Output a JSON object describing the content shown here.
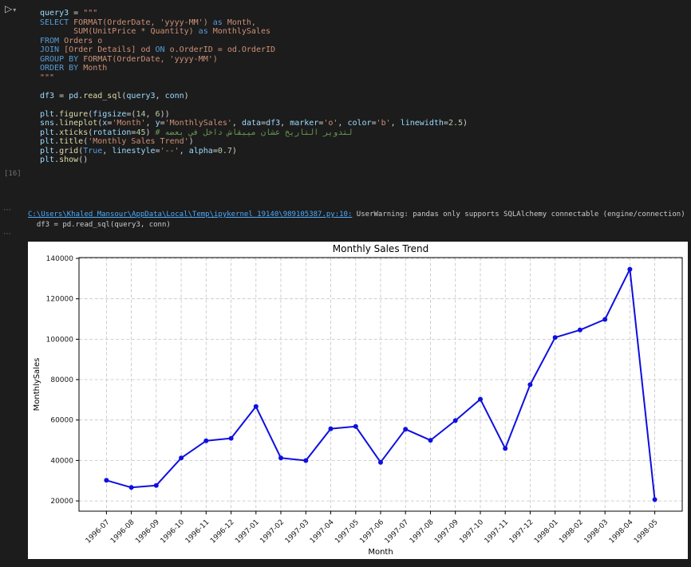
{
  "colors": {
    "page_bg": "#1c1c1c",
    "accent_link": "#4daafc",
    "chart_line": "#0f0fe0",
    "syntax": {
      "var": "#9cdcfe",
      "fg": "#d4d4d4",
      "str": "#ce9178",
      "kw": "#569cd6",
      "fn": "#dcdcaa",
      "num": "#b5cea8",
      "com": "#6a9955"
    }
  },
  "cell": {
    "run_icon": "▷",
    "dropdown_icon": "▾",
    "execution_count": "[16]",
    "code_lines": [
      [
        {
          "t": "query3",
          "c": "var"
        },
        {
          "t": " = ",
          "c": "fg"
        },
        {
          "t": "\"\"\"",
          "c": "str"
        }
      ],
      [
        {
          "t": "SELECT",
          "c": "kw"
        },
        {
          "t": " FORMAT(OrderDate, 'yyyy-MM')",
          "c": "str"
        },
        {
          "t": " as ",
          "c": "kw"
        },
        {
          "t": "Month,",
          "c": "str"
        }
      ],
      [
        {
          "t": "       SUM(UnitPrice * Quantity)",
          "c": "str"
        },
        {
          "t": " as ",
          "c": "kw"
        },
        {
          "t": "MonthlySales",
          "c": "str"
        }
      ],
      [
        {
          "t": "FROM",
          "c": "kw"
        },
        {
          "t": " Orders o",
          "c": "str"
        }
      ],
      [
        {
          "t": "JOIN",
          "c": "kw"
        },
        {
          "t": " [Order Details] od ",
          "c": "str"
        },
        {
          "t": "ON",
          "c": "kw"
        },
        {
          "t": " o.OrderID = od.OrderID",
          "c": "str"
        }
      ],
      [
        {
          "t": "GROUP BY",
          "c": "kw"
        },
        {
          "t": " FORMAT(OrderDate, 'yyyy-MM')",
          "c": "str"
        }
      ],
      [
        {
          "t": "ORDER BY",
          "c": "kw"
        },
        {
          "t": " Month",
          "c": "str"
        }
      ],
      [
        {
          "t": "\"\"\"",
          "c": "str"
        }
      ],
      [],
      [
        {
          "t": "df3",
          "c": "var"
        },
        {
          "t": " = ",
          "c": "fg"
        },
        {
          "t": "pd",
          "c": "var"
        },
        {
          "t": ".",
          "c": "fg"
        },
        {
          "t": "read_sql",
          "c": "fn"
        },
        {
          "t": "(",
          "c": "fg"
        },
        {
          "t": "query3",
          "c": "var"
        },
        {
          "t": ", ",
          "c": "fg"
        },
        {
          "t": "conn",
          "c": "var"
        },
        {
          "t": ")",
          "c": "fg"
        }
      ],
      [],
      [
        {
          "t": "plt",
          "c": "var"
        },
        {
          "t": ".",
          "c": "fg"
        },
        {
          "t": "figure",
          "c": "fn"
        },
        {
          "t": "(",
          "c": "fg"
        },
        {
          "t": "figsize",
          "c": "var"
        },
        {
          "t": "=(",
          "c": "fg"
        },
        {
          "t": "14",
          "c": "num"
        },
        {
          "t": ", ",
          "c": "fg"
        },
        {
          "t": "6",
          "c": "num"
        },
        {
          "t": "))",
          "c": "fg"
        }
      ],
      [
        {
          "t": "sns",
          "c": "var"
        },
        {
          "t": ".",
          "c": "fg"
        },
        {
          "t": "lineplot",
          "c": "fn"
        },
        {
          "t": "(",
          "c": "fg"
        },
        {
          "t": "x",
          "c": "var"
        },
        {
          "t": "=",
          "c": "fg"
        },
        {
          "t": "'Month'",
          "c": "str"
        },
        {
          "t": ", ",
          "c": "fg"
        },
        {
          "t": "y",
          "c": "var"
        },
        {
          "t": "=",
          "c": "fg"
        },
        {
          "t": "'MonthlySales'",
          "c": "str"
        },
        {
          "t": ", ",
          "c": "fg"
        },
        {
          "t": "data",
          "c": "var"
        },
        {
          "t": "=",
          "c": "fg"
        },
        {
          "t": "df3",
          "c": "var"
        },
        {
          "t": ", ",
          "c": "fg"
        },
        {
          "t": "marker",
          "c": "var"
        },
        {
          "t": "=",
          "c": "fg"
        },
        {
          "t": "'o'",
          "c": "str"
        },
        {
          "t": ", ",
          "c": "fg"
        },
        {
          "t": "color",
          "c": "var"
        },
        {
          "t": "=",
          "c": "fg"
        },
        {
          "t": "'b'",
          "c": "str"
        },
        {
          "t": ", ",
          "c": "fg"
        },
        {
          "t": "linewidth",
          "c": "var"
        },
        {
          "t": "=",
          "c": "fg"
        },
        {
          "t": "2.5",
          "c": "num"
        },
        {
          "t": ")",
          "c": "fg"
        }
      ],
      [
        {
          "t": "plt",
          "c": "var"
        },
        {
          "t": ".",
          "c": "fg"
        },
        {
          "t": "xticks",
          "c": "fn"
        },
        {
          "t": "(",
          "c": "fg"
        },
        {
          "t": "rotation",
          "c": "var"
        },
        {
          "t": "=",
          "c": "fg"
        },
        {
          "t": "45",
          "c": "num"
        },
        {
          "t": ") ",
          "c": "fg"
        },
        {
          "t": "# لتدوير التاريخ عشان ميبقاش داخل في بعضه",
          "c": "com"
        }
      ],
      [
        {
          "t": "plt",
          "c": "var"
        },
        {
          "t": ".",
          "c": "fg"
        },
        {
          "t": "title",
          "c": "fn"
        },
        {
          "t": "(",
          "c": "fg"
        },
        {
          "t": "'Monthly Sales Trend'",
          "c": "str"
        },
        {
          "t": ")",
          "c": "fg"
        }
      ],
      [
        {
          "t": "plt",
          "c": "var"
        },
        {
          "t": ".",
          "c": "fg"
        },
        {
          "t": "grid",
          "c": "fn"
        },
        {
          "t": "(",
          "c": "fg"
        },
        {
          "t": "True",
          "c": "kw"
        },
        {
          "t": ", ",
          "c": "fg"
        },
        {
          "t": "linestyle",
          "c": "var"
        },
        {
          "t": "=",
          "c": "fg"
        },
        {
          "t": "'--'",
          "c": "str"
        },
        {
          "t": ", ",
          "c": "fg"
        },
        {
          "t": "alpha",
          "c": "var"
        },
        {
          "t": "=",
          "c": "fg"
        },
        {
          "t": "0.7",
          "c": "num"
        },
        {
          "t": ")",
          "c": "fg"
        }
      ],
      [
        {
          "t": "plt",
          "c": "var"
        },
        {
          "t": ".",
          "c": "fg"
        },
        {
          "t": "show",
          "c": "fn"
        },
        {
          "t": "()",
          "c": "fg"
        }
      ]
    ]
  },
  "outputs": {
    "menu_dots": "⋯",
    "warning": {
      "link": "C:\\Users\\Khaled Mansour\\AppData\\Local\\Temp\\ipykernel_19140\\989105387.py:10:",
      "message": " UserWarning: pandas only supports SQLAlchemy connectable (engine/connection) or",
      "code_context": "  df3 = pd.read_sql(query3, conn)"
    }
  },
  "chart_data": {
    "type": "line",
    "title": "Monthly Sales Trend",
    "xlabel": "Month",
    "ylabel": "MonthlySales",
    "categories": [
      "1996-07",
      "1996-08",
      "1996-09",
      "1996-10",
      "1996-11",
      "1996-12",
      "1997-01",
      "1997-02",
      "1997-03",
      "1997-04",
      "1997-05",
      "1997-06",
      "1997-07",
      "1997-08",
      "1997-09",
      "1997-10",
      "1997-11",
      "1997-12",
      "1998-01",
      "1998-02",
      "1998-03",
      "1998-04",
      "1998-05"
    ],
    "series": [
      {
        "name": "MonthlySales",
        "values": [
          30192,
          26609,
          27636,
          41204,
          49704,
          50953,
          66693,
          41207,
          39980,
          55699,
          56824,
          39088,
          55465,
          49982,
          59733,
          70329,
          45913,
          77476,
          100855,
          104562,
          109825,
          134631,
          20617
        ]
      }
    ],
    "ylim": [
      14900,
      140400
    ],
    "yticks": [
      20000,
      40000,
      60000,
      80000,
      100000,
      120000,
      140000
    ],
    "grid": true,
    "grid_style": "dashed",
    "legend": "none",
    "marker": "o",
    "line_color": "#0f0fe0",
    "xtick_rotation": 45
  }
}
